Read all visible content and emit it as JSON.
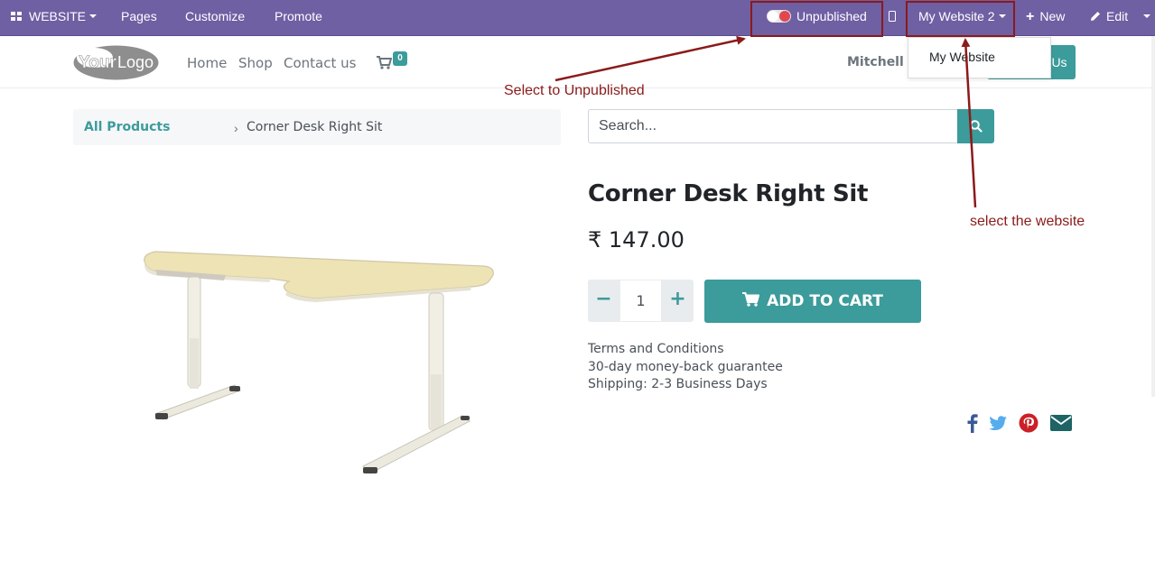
{
  "admin_bar": {
    "app_menu": "WEBSITE",
    "pages": "Pages",
    "customize": "Customize",
    "promote": "Promote",
    "publish_status": "Unpublished",
    "website_selector": "My Website 2",
    "new": "New",
    "edit": "Edit"
  },
  "website_dropdown": {
    "options": [
      "My Website"
    ]
  },
  "header": {
    "nav": [
      "Home",
      "Shop",
      "Contact us"
    ],
    "cart_count": "0",
    "user_name": "Mitchell A",
    "contact_button": "Us"
  },
  "breadcrumb": {
    "parent": "All Products",
    "current": "Corner Desk Right Sit"
  },
  "search": {
    "placeholder": "Search..."
  },
  "product": {
    "name": "Corner Desk Right Sit",
    "price": "₹ 147.00",
    "quantity": "1",
    "add_to_cart": "ADD TO CART",
    "terms": [
      "Terms and Conditions",
      "30-day money-back guarantee",
      "Shipping: 2-3 Business Days"
    ]
  },
  "share_icons": [
    "facebook-icon",
    "twitter-icon",
    "pinterest-icon",
    "envelope-icon"
  ],
  "annotations": {
    "unpublish_note": "Select to Unpublished",
    "website_note": "select the website",
    "color": "#8b1a1a"
  },
  "colors": {
    "admin_bar": "#6f5fa3",
    "accent": "#3c9b9b"
  }
}
